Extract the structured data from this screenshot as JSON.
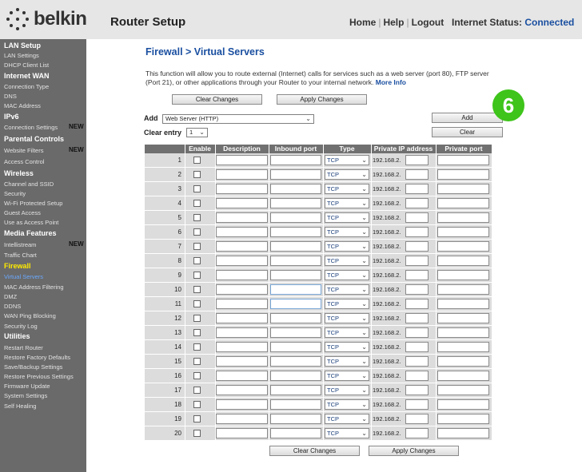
{
  "header": {
    "logo": "belkin",
    "app_title": "Router Setup",
    "nav": {
      "home": "Home",
      "help": "Help",
      "logout": "Logout",
      "separator": "|"
    },
    "status_label": "Internet Status:",
    "status_value": "Connected"
  },
  "sidebar": {
    "items": [
      {
        "type": "section",
        "label": "LAN Setup"
      },
      {
        "type": "item",
        "label": "LAN Settings"
      },
      {
        "type": "item",
        "label": "DHCP Client List"
      },
      {
        "type": "section",
        "label": "Internet WAN"
      },
      {
        "type": "item",
        "label": "Connection Type"
      },
      {
        "type": "item",
        "label": "DNS"
      },
      {
        "type": "item",
        "label": "MAC Address"
      },
      {
        "type": "section",
        "label": "IPv6"
      },
      {
        "type": "item",
        "label": "Connection Settings",
        "badge": "NEW"
      },
      {
        "type": "section",
        "label": "Parental Controls"
      },
      {
        "type": "item",
        "label": "Website Filters",
        "badge": "NEW"
      },
      {
        "type": "item",
        "label": "Access Control"
      },
      {
        "type": "section",
        "label": "Wireless"
      },
      {
        "type": "item",
        "label": "Channel and SSID"
      },
      {
        "type": "item",
        "label": "Security"
      },
      {
        "type": "item",
        "label": "Wi-Fi Protected Setup"
      },
      {
        "type": "item",
        "label": "Guest Access"
      },
      {
        "type": "item",
        "label": "Use as Access Point"
      },
      {
        "type": "section",
        "label": "Media Features"
      },
      {
        "type": "item",
        "label": "Intellistream",
        "badge": "NEW"
      },
      {
        "type": "item",
        "label": "Traffic Chart"
      },
      {
        "type": "section",
        "label": "Firewall",
        "active": true
      },
      {
        "type": "item",
        "label": "Virtual Servers",
        "active": true
      },
      {
        "type": "item",
        "label": "MAC Address Filtering"
      },
      {
        "type": "item",
        "label": "DMZ"
      },
      {
        "type": "item",
        "label": "DDNS"
      },
      {
        "type": "item",
        "label": "WAN Ping Blocking"
      },
      {
        "type": "item",
        "label": "Security Log"
      },
      {
        "type": "section",
        "label": "Utilities"
      },
      {
        "type": "item",
        "label": "Restart Router"
      },
      {
        "type": "item",
        "label": "Restore Factory Defaults"
      },
      {
        "type": "item",
        "label": "Save/Backup Settings"
      },
      {
        "type": "item",
        "label": "Restore Previous Settings"
      },
      {
        "type": "item",
        "label": "Firmware Update"
      },
      {
        "type": "item",
        "label": "System Settings"
      },
      {
        "type": "item",
        "label": "Self Healing"
      }
    ]
  },
  "main": {
    "title": "Firewall > Virtual Servers",
    "description": "This function will allow you to route external (Internet) calls for services such as a web server (port 80), FTP server (Port 21), or other applications through your Router to your internal network.",
    "more_info": "More Info",
    "clear_changes": "Clear Changes",
    "apply_changes": "Apply Changes",
    "add_label": "Add",
    "add_select_value": "Web Server (HTTP)",
    "add_button": "Add",
    "clear_entry_label": "Clear entry",
    "clear_entry_value": "1",
    "clear_button": "Clear",
    "step_badge": "6"
  },
  "table": {
    "headers": [
      "Enable",
      "Description",
      "Inbound port",
      "Type",
      "Private IP address",
      "Private port"
    ],
    "type_value": "TCP",
    "ip_prefix": "192.168.2.",
    "rows": [
      "1",
      "2",
      "3",
      "4",
      "5",
      "6",
      "7",
      "8",
      "9",
      "10",
      "11",
      "12",
      "13",
      "14",
      "15",
      "16",
      "17",
      "18",
      "19",
      "20"
    ]
  },
  "colors": {
    "title_blue": "#1a4fa0",
    "sidebar_bg": "#6a6a6a",
    "active_section": "#ffea00",
    "active_item": "#6aa9ff",
    "badge_green": "#3ec41a"
  }
}
